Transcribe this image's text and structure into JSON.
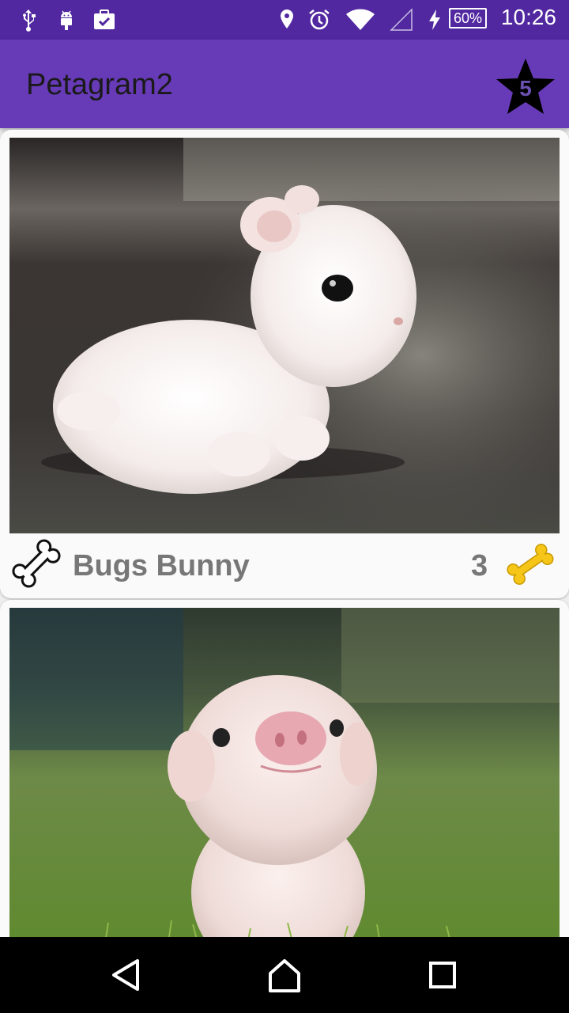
{
  "status_bar": {
    "time": "10:26",
    "battery": "60%",
    "icons": [
      "usb-icon",
      "android-debug-icon",
      "briefcase-check-icon",
      "location-icon",
      "alarm-icon",
      "wifi-icon",
      "cell-signal-icon",
      "charging-icon",
      "battery-icon"
    ]
  },
  "app_bar": {
    "title": "Petagram2",
    "star_count": "5",
    "background": "#673ab7",
    "status_background": "#5128a0"
  },
  "pets": [
    {
      "name": "Bugs Bunny",
      "likes": "3",
      "photo": "white bunny on dark floor"
    },
    {
      "name": "",
      "likes": "",
      "photo": "pink piglet on grass"
    }
  ],
  "nav_bar": {
    "buttons": [
      "back-icon",
      "home-icon",
      "recents-icon"
    ]
  }
}
